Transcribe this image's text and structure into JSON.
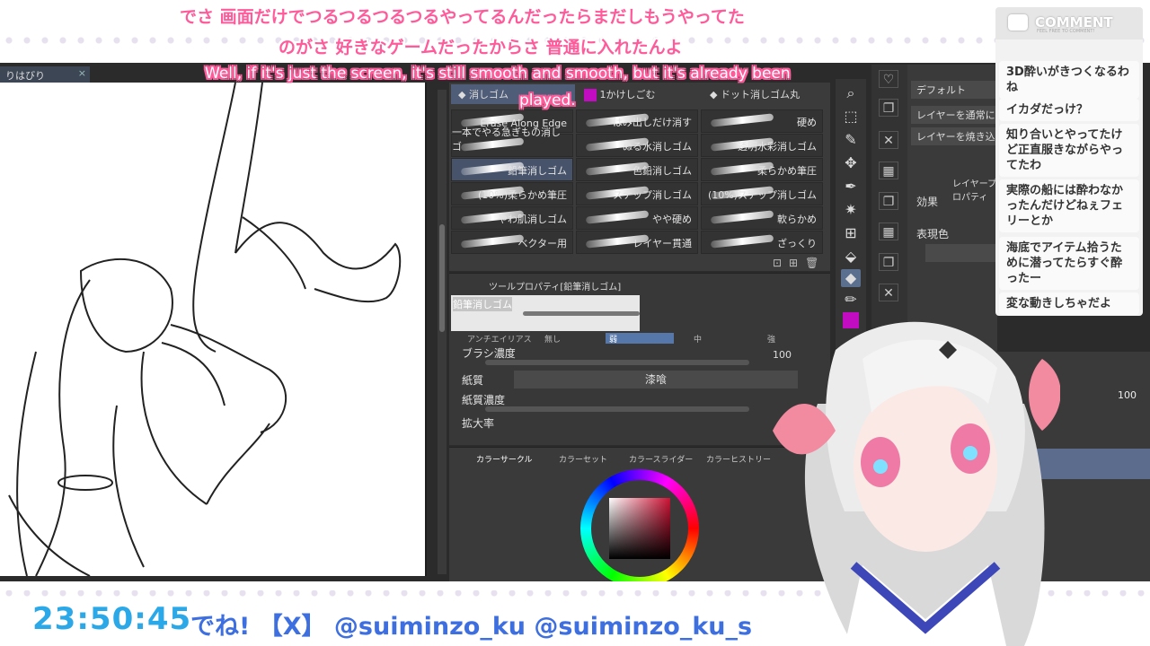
{
  "subtitles": {
    "jp_line1": "でさ 画面だけでつるつるつるつるやってるんだったらまだしもうやってた",
    "jp_line2": "のがさ 好きなゲームだったからさ 普通に入れたんよ",
    "en_line1": "Well, if it's just the screen, it's still smooth and smooth, but it's already been",
    "en_line2": "played."
  },
  "document": {
    "tab_label": "りはびり",
    "close_glyph": "×"
  },
  "subtool": {
    "tabs": [
      "消しゴム",
      "1かけしごむ",
      "ドット消しゴム丸"
    ],
    "brushes": [
      {
        "label": "Erase Along Edge",
        "selected": false
      },
      {
        "label": "はみ出しだけ消す",
        "selected": false
      },
      {
        "label": "硬め",
        "selected": false
      },
      {
        "label": "一本でやる急ぎもの消しゴ",
        "selected": false
      },
      {
        "label": "ぬる水消しゴム",
        "selected": false
      },
      {
        "label": "透明水彩消しゴム",
        "selected": false
      },
      {
        "label": "鉛筆消しゴム",
        "selected": true
      },
      {
        "label": "色鉛消しゴム",
        "selected": false
      },
      {
        "label": "柔らかめ筆圧",
        "selected": false
      },
      {
        "label": "(10%)柔らかめ筆圧",
        "selected": false
      },
      {
        "label": "スナップ消しゴム",
        "selected": false
      },
      {
        "label": "(10%)スナップ消しゴム",
        "selected": false
      },
      {
        "label": "やわ肌消しゴム",
        "selected": false
      },
      {
        "label": "やや硬め",
        "selected": false
      },
      {
        "label": "軟らかめ",
        "selected": false
      },
      {
        "label": "ベクター用",
        "selected": false
      },
      {
        "label": "レイヤー貫通",
        "selected": false
      },
      {
        "label": "ざっくり",
        "selected": false
      }
    ]
  },
  "tool_property": {
    "title": "ツールプロパティ[鉛筆消しゴム]",
    "preview_name": "鉛筆消しゴム",
    "anti_alias_label": "アンチエイリアス",
    "anti_alias_options": [
      "無し",
      "弱",
      "中",
      "強"
    ],
    "brush_density_label": "ブラシ濃度",
    "brush_density_value": "100",
    "paper_label": "紙質",
    "paper_value": "漆喰",
    "paper_density_label": "紙質濃度",
    "scale_label": "拡大率"
  },
  "color_panel": {
    "tabs": [
      "カラーサークル",
      "カラーセット",
      "カラースライダー",
      "カラーヒストリー"
    ]
  },
  "layer_panel": {
    "blend_mode": "デフォルト",
    "button1": "レイヤーを通常にする",
    "button2": "レイヤーを焼き込み",
    "property_title": "レイヤープロパティ",
    "effect_label": "効果",
    "expression_label": "表現色",
    "opacity_value": "100"
  },
  "comments": {
    "title": "COMMENT",
    "subtitle": "FEEL FREE TO COMMENT!",
    "items": [
      "3D酔いがきつくなるわね",
      "イカダだっけ？",
      "知り合いとやってたけど正直服きながらやってたわ",
      "実際の船には酔わなかったんだけどねぇフェリーとか",
      "海底でアイテム拾うために潜ってたらすぐ酔ったー",
      "変な動きしちゃだよ"
    ]
  },
  "footer": {
    "clock": "23:50:45",
    "ticker": "でね!  【X】 @suiminzo_ku  @suiminzo_ku_s"
  },
  "colors": {
    "accent_pink": "#ff5a9a",
    "clock_blue": "#2aa8e8",
    "ticker_blue": "#3d6fe0",
    "selected_panel": "#46536b"
  }
}
